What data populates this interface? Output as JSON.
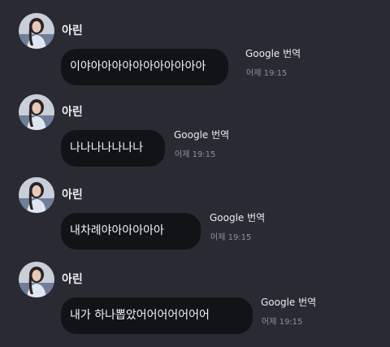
{
  "messages": [
    {
      "sender": "아린",
      "text": "이야아아아아아아아아아아아",
      "translate_label": "Google 번역",
      "time": "어제 19:15"
    },
    {
      "sender": "아린",
      "text": "나나나나나나나",
      "translate_label": "Google 번역",
      "time": "어제 19:15"
    },
    {
      "sender": "아린",
      "text": "내차례야아아아아아",
      "translate_label": "Google 번역",
      "time": "어제 19:15"
    },
    {
      "sender": "아린",
      "text": "내가 하나뽑았어어어어어어어",
      "translate_label": "Google 번역",
      "time": "어제 19:15"
    }
  ],
  "colors": {
    "background": "#2a2b32",
    "bubble": "#121316",
    "text": "#f4f4f6",
    "timestamp": "#8f9098"
  }
}
